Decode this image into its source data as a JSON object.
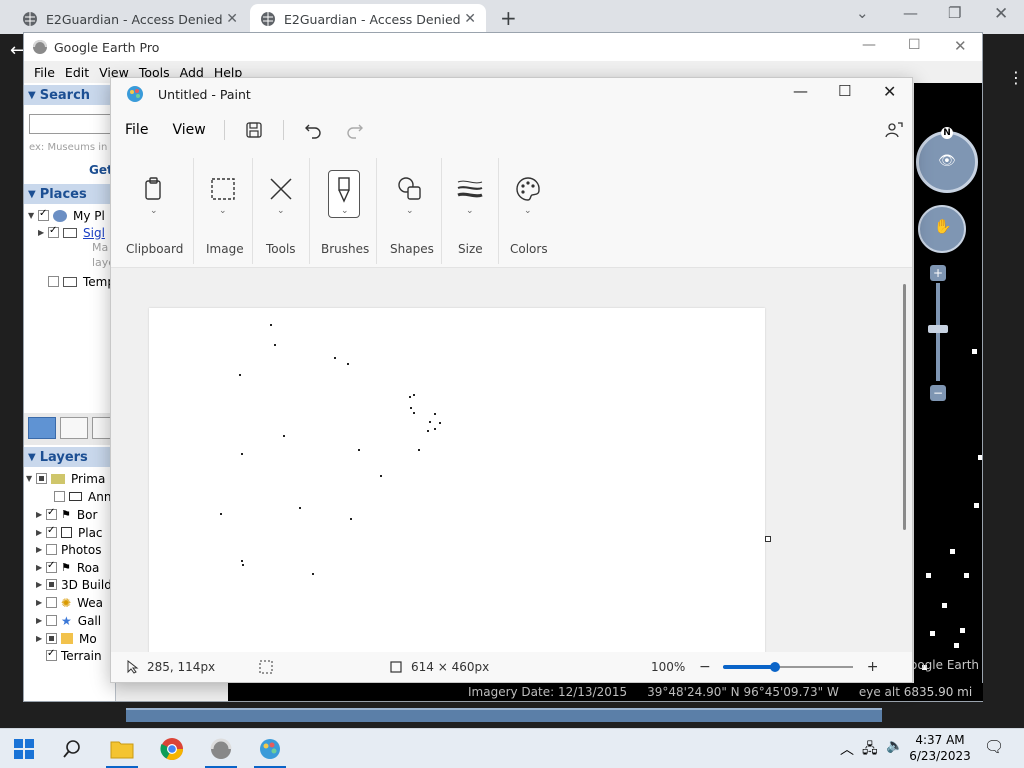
{
  "browser": {
    "tabs": [
      {
        "title": "E2Guardian - Access Denied",
        "active": false
      },
      {
        "title": "E2Guardian - Access Denied",
        "active": true
      }
    ]
  },
  "google_earth": {
    "title": "Google Earth Pro",
    "menu": [
      "File",
      "Edit",
      "View",
      "Tools",
      "Add",
      "Help"
    ],
    "search": {
      "header": "Search",
      "placeholder": "ex: Museums in I",
      "get_label": "Get"
    },
    "places": {
      "header": "Places",
      "items": [
        {
          "label": "My Pl",
          "checked": true,
          "indent": 1
        },
        {
          "label": "Sigl",
          "checked": true,
          "indent": 2
        },
        {
          "label": "Ma",
          "checked": null,
          "indent": 3
        },
        {
          "label": "laye",
          "checked": null,
          "indent": 3
        },
        {
          "label": "Tempo",
          "checked": false,
          "indent": 1
        }
      ]
    },
    "layers": {
      "header": "Layers",
      "items": [
        {
          "label": "Prima",
          "state": "partial",
          "indent": 0
        },
        {
          "label": "Ann",
          "state": "off",
          "indent": 1
        },
        {
          "label": "Bor",
          "state": "on",
          "indent": 1
        },
        {
          "label": "Plac",
          "state": "on",
          "indent": 1
        },
        {
          "label": "Photos",
          "state": "off",
          "indent": 1
        },
        {
          "label": "Roa",
          "state": "on",
          "indent": 1
        },
        {
          "label": "3D Build",
          "state": "partial",
          "indent": 1
        },
        {
          "label": "Wea",
          "state": "off",
          "indent": 1
        },
        {
          "label": "Gall",
          "state": "off",
          "indent": 1
        },
        {
          "label": "Mo",
          "state": "partial",
          "indent": 1
        },
        {
          "label": "Terrain",
          "state": "on",
          "indent": 1
        }
      ]
    },
    "status": {
      "imagery_date": "Imagery Date: 12/13/2015",
      "coords": "39°48'24.90\" N   96°45'09.73\" W",
      "eye_alt": "eye alt 6835.90 mi",
      "watermark": "oogle Earth"
    },
    "compass_label": "N"
  },
  "paint": {
    "title": "Untitled - Paint",
    "menu": {
      "file": "File",
      "view": "View"
    },
    "ribbon": [
      "Clipboard",
      "Image",
      "Tools",
      "Brushes",
      "Shapes",
      "Size",
      "Colors"
    ],
    "status": {
      "cursor_pos": "285, 114px",
      "canvas_size": "614 × 460px",
      "zoom": "100%",
      "zoom_fraction": 0.4
    }
  },
  "taskbar": {
    "time": "4:37 AM",
    "date": "6/23/2023"
  },
  "colors": {
    "accent": "#0a64c8",
    "ge_header": "#1c4f93"
  }
}
